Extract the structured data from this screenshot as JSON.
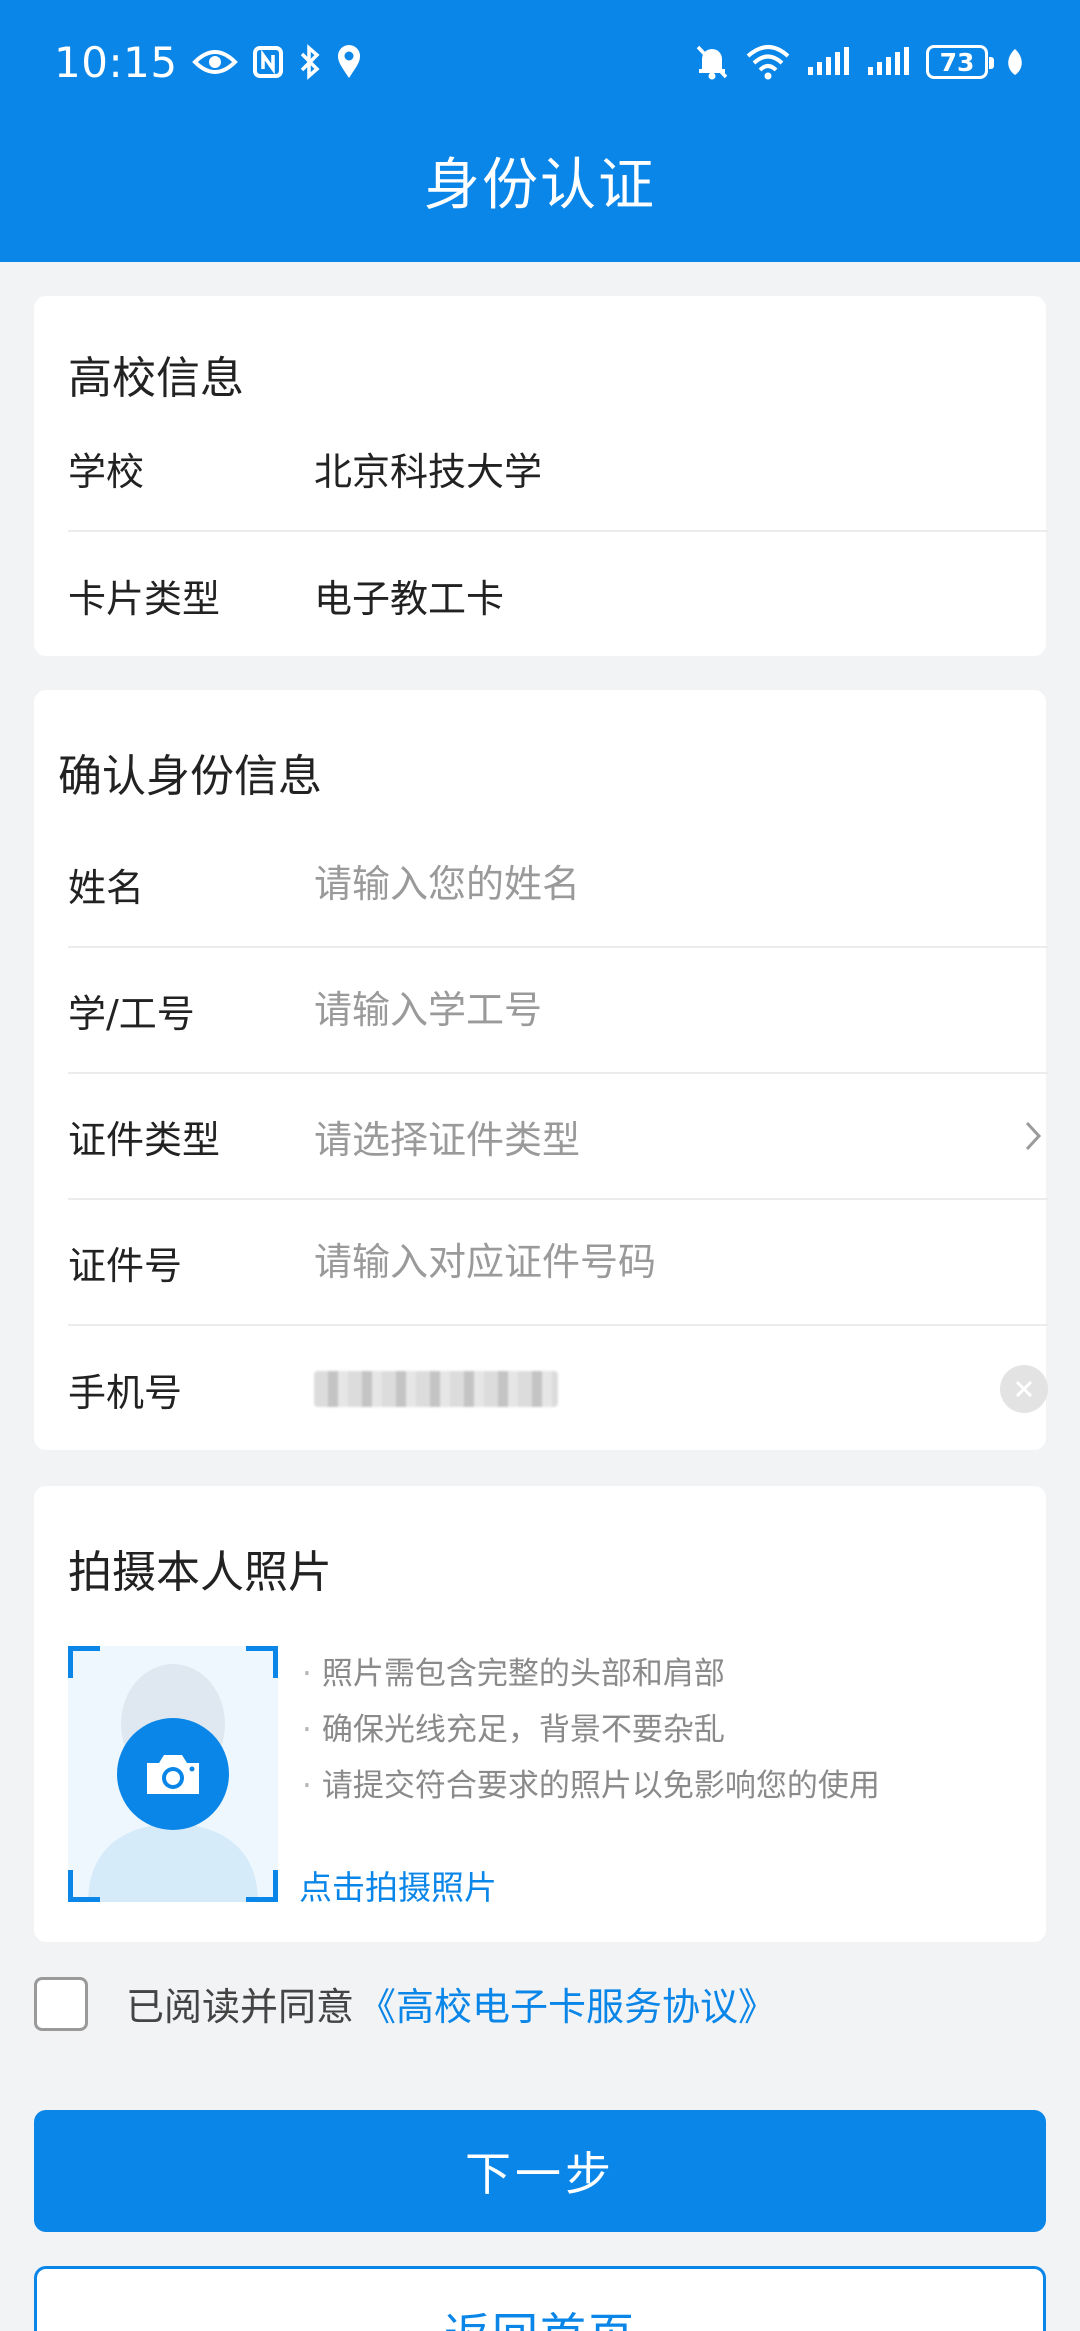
{
  "status_bar": {
    "time": "10:15",
    "battery": "73"
  },
  "header": {
    "title": "身份认证"
  },
  "school_card": {
    "title": "高校信息",
    "rows": [
      {
        "label": "学校",
        "value": "北京科技大学"
      },
      {
        "label": "卡片类型",
        "value": "电子教工卡"
      }
    ]
  },
  "identity_card": {
    "title": "确认身份信息",
    "name": {
      "label": "姓名",
      "placeholder": "请输入您的姓名"
    },
    "staff_id": {
      "label": "学/工号",
      "placeholder": "请输入学工号"
    },
    "id_type": {
      "label": "证件类型",
      "placeholder": "请选择证件类型"
    },
    "id_number": {
      "label": "证件号",
      "placeholder": "请输入对应证件号码"
    },
    "phone": {
      "label": "手机号"
    }
  },
  "photo_card": {
    "title": "拍摄本人照片",
    "tips": [
      "照片需包含完整的头部和肩部",
      "确保光线充足，背景不要杂乱",
      "请提交符合要求的照片以免影响您的使用"
    ],
    "tip_bullet": "·",
    "take_photo": "点击拍摄照片"
  },
  "agreement": {
    "text": "已阅读并同意",
    "link": "《高校电子卡服务协议》"
  },
  "buttons": {
    "next": "下一步",
    "home": "返回首页"
  },
  "colors": {
    "accent": "#0a86e8",
    "background": "#f2f3f5"
  }
}
